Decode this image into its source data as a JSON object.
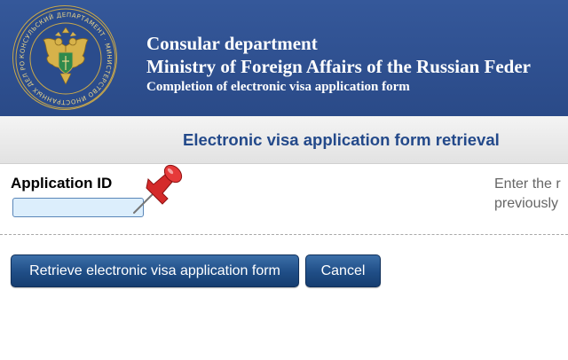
{
  "header": {
    "line1": "Consular department",
    "line2": "Ministry of Foreign Affairs of the Russian Feder",
    "line3": "Completion of electronic visa application form",
    "emblem": {
      "icon": "double-headed-eagle-emblem-icon",
      "ring_text": "КОНСУЛЬСКИЙ ДЕПАРТАМЕНТ · МИНИСТЕРСТВО ИНОСТРАННЫХ ДЕЛ РОССИИ"
    }
  },
  "titlebar": {
    "title": "Electronic visa application form retrieval"
  },
  "form": {
    "application_id_label": "Application ID",
    "application_id_value": "",
    "application_id_placeholder": "",
    "pin_icon": "push-pin-icon",
    "hint_line1": "Enter the r",
    "hint_line2": "previously"
  },
  "buttons": {
    "retrieve_label": "Retrieve electronic visa application form",
    "cancel_label": "Cancel"
  },
  "colors": {
    "header_bg": "#2b4c8c",
    "title_text": "#23498a",
    "button_bg": "#1f4d86",
    "input_bg": "#dceefc",
    "pin_red": "#d42a2a"
  }
}
